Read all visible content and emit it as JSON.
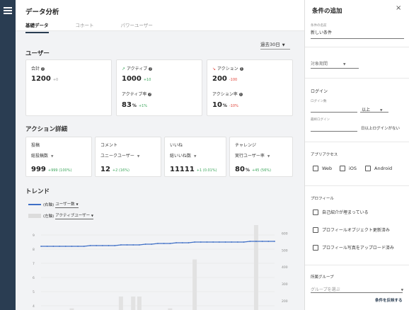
{
  "header": {
    "title": "データ分析",
    "tabs": [
      "基礎データ",
      "コホート",
      "パワーユーザー"
    ]
  },
  "period": "過去30日",
  "users": {
    "title": "ユーザー",
    "total": {
      "label": "合計",
      "value": "1200",
      "delta": "+0"
    },
    "active": {
      "label": "アクティブ",
      "value": "1000",
      "delta": "+10",
      "rate_label": "アクティブ率",
      "rate": "83",
      "rate_unit": "%",
      "rate_delta": "+1%"
    },
    "action": {
      "label": "アクション",
      "value": "200",
      "delta": "-100",
      "rate_label": "アクション率",
      "rate": "10",
      "rate_unit": "%",
      "rate_delta": "-10%"
    }
  },
  "action_detail": {
    "title": "アクション詳細",
    "cards": [
      {
        "label": "投稿",
        "select": "総投稿数",
        "value": "999",
        "delta": "+999 (100%)"
      },
      {
        "label": "コメント",
        "select": "ユニークユーザー",
        "value": "12",
        "delta": "+2 (16%)"
      },
      {
        "label": "いいね",
        "select": "総いいね数",
        "value": "11111",
        "delta": "+1 (0.01%)"
      },
      {
        "label": "チャレンジ",
        "select": "実行ユーザー率",
        "value": "80",
        "unit": "%",
        "delta": "+45 (56%)"
      }
    ]
  },
  "trend": {
    "title": "トレンド",
    "legend_right_axis": "(右軸)",
    "legend_right_select": "ユーザー数",
    "legend_left_axis": "(左軸)",
    "legend_left_select": "アクティブユーザー"
  },
  "chart_data": {
    "type": "bar",
    "line_series": {
      "name": "ユーザー数",
      "axis": "left",
      "values": [
        8.2,
        8.2,
        8.2,
        8.2,
        8.2,
        8.2,
        8.2,
        8.2,
        8.25,
        8.25,
        8.25,
        8.25,
        8.25,
        8.3,
        8.3,
        8.3,
        8.3,
        8.35,
        8.35,
        8.4,
        8.4,
        8.4,
        8.45,
        8.45,
        8.45,
        8.5,
        8.5,
        8.5,
        8.5,
        8.5,
        8.5,
        8.5,
        8.5,
        8.5,
        8.55,
        8.55,
        8.55,
        8.55,
        8.55
      ]
    },
    "bar_series": {
      "name": "アクティブユーザー",
      "axis": "right",
      "values": [
        0,
        0,
        0,
        0,
        0,
        10,
        0,
        0,
        0,
        0,
        0,
        0,
        0,
        80,
        0,
        80,
        80,
        0,
        0,
        0,
        0,
        10,
        0,
        0,
        0,
        300,
        0,
        0,
        0,
        0,
        0,
        0,
        0,
        0,
        0,
        600,
        0,
        0,
        0
      ]
    },
    "left_ticks": [
      "9",
      "8",
      "7",
      "6",
      "5",
      "4"
    ],
    "right_ticks": [
      "600",
      "500",
      "400",
      "300",
      "200"
    ],
    "left_range": [
      3.7,
      9.3
    ],
    "right_range": [
      145,
      615
    ]
  },
  "panel": {
    "title": "条件の追加",
    "close": "×",
    "name_label": "条件の名前",
    "name_value": "新しい条件",
    "period_label": "対象期間",
    "login_title": "ログイン",
    "login_count_label": "ログイン数",
    "login_op": "以上",
    "last_login_label": "最終ログイン",
    "last_login_suffix": "日以上ログインがない",
    "app_access_title": "アプリアクセス",
    "app_options": [
      "Web",
      "iOS",
      "Android"
    ],
    "profile_title": "プロフィール",
    "profile_options": [
      "自己紹介が埋まっている",
      "プロフィールオブジェクト更新済み",
      "プロフィール写真をアップロード済み"
    ],
    "group_title": "所属グループ",
    "group_placeholder": "グループを選ぶ",
    "apply_label": "条件を反映する"
  }
}
